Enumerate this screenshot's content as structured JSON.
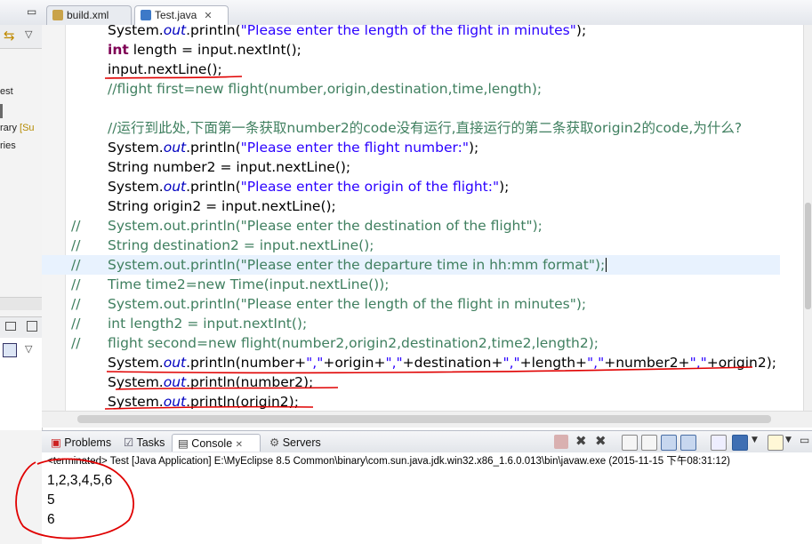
{
  "left_panel": {
    "items": [
      "est",
      "rary",
      "[Su",
      "ries"
    ]
  },
  "editor_tabs": [
    {
      "label": "build.xml",
      "active": false
    },
    {
      "label": "Test.java",
      "active": true
    }
  ],
  "code_lines": [
    {
      "gutter": "",
      "html": "System.<span class='fi'>out</span>.println(<span class='st'>\"Please enter the length of the flight in minutes\"</span>);"
    },
    {
      "gutter": "",
      "html": "<span class='kw'>int</span> length = input.nextInt();"
    },
    {
      "gutter": "",
      "html": "input.nextLine();"
    },
    {
      "gutter": "",
      "html": "<span class='cm'>//flight first=new flight(number,origin,destination,time,length);</span>"
    },
    {
      "gutter": "",
      "html": ""
    },
    {
      "gutter": "",
      "html": "<span class='cm'>//运行到此处,下面第一条获取number2的code没有运行,直接运行的第二条获取origin2的code,为什么?</span>"
    },
    {
      "gutter": "",
      "html": "System.<span class='fi'>out</span>.println(<span class='st'>\"Please enter the flight number:\"</span>);"
    },
    {
      "gutter": "",
      "html": "String number2 = input.nextLine();"
    },
    {
      "gutter": "",
      "html": "System.<span class='fi'>out</span>.println(<span class='st'>\"Please enter the origin of the flight:\"</span>);"
    },
    {
      "gutter": "",
      "html": "String origin2 = input.nextLine();"
    },
    {
      "gutter": "//",
      "html": "<span class='cm'>System.out.println(\"Please enter the destination of the flight\");</span>"
    },
    {
      "gutter": "//",
      "html": "<span class='cm'>String destination2 = input.nextLine();</span>"
    },
    {
      "gutter": "//",
      "html": "<span class='cm'>System.out.println(\"Please enter the departure time in hh:mm format\");</span><span class='caret'></span>",
      "current": true
    },
    {
      "gutter": "//",
      "html": "<span class='cm'>Time time2=new Time(input.nextLine());</span>"
    },
    {
      "gutter": "//",
      "html": "<span class='cm'>System.out.println(\"Please enter the length of the flight in minutes\");</span>"
    },
    {
      "gutter": "//",
      "html": "<span class='cm'>int length2 = input.nextInt();</span>"
    },
    {
      "gutter": "//",
      "html": "<span class='cm'>flight second=new flight(number2,origin2,destination2,time2,length2);</span>"
    },
    {
      "gutter": "",
      "html": "System.<span class='fi'>out</span>.println(number+<span class='st'>\",\"</span>+origin+<span class='st'>\",\"</span>+destination+<span class='st'>\",\"</span>+length+<span class='st'>\",\"</span>+number2+<span class='st'>\",\"</span>+origin2);"
    },
    {
      "gutter": "",
      "html": "System.<span class='fi'>out</span>.println(number2);"
    },
    {
      "gutter": "",
      "html": "System.<span class='fi'>out</span>.println(origin2);"
    }
  ],
  "views": {
    "problems": "Problems",
    "tasks": "Tasks",
    "console": "Console",
    "servers": "Servers"
  },
  "console": {
    "status": "<terminated> Test [Java Application] E:\\MyEclipse 8.5 Common\\binary\\com.sun.java.jdk.win32.x86_1.6.0.013\\bin\\javaw.exe (2015-11-15 下午08:31:12)",
    "output": [
      "1,2,3,4,5,6",
      "5",
      "6"
    ]
  },
  "colors": {
    "comment": "#3f7f5f",
    "string": "#2a00ff",
    "keyword": "#7f0055",
    "field": "#0000c0",
    "annotation": "#e00000"
  }
}
